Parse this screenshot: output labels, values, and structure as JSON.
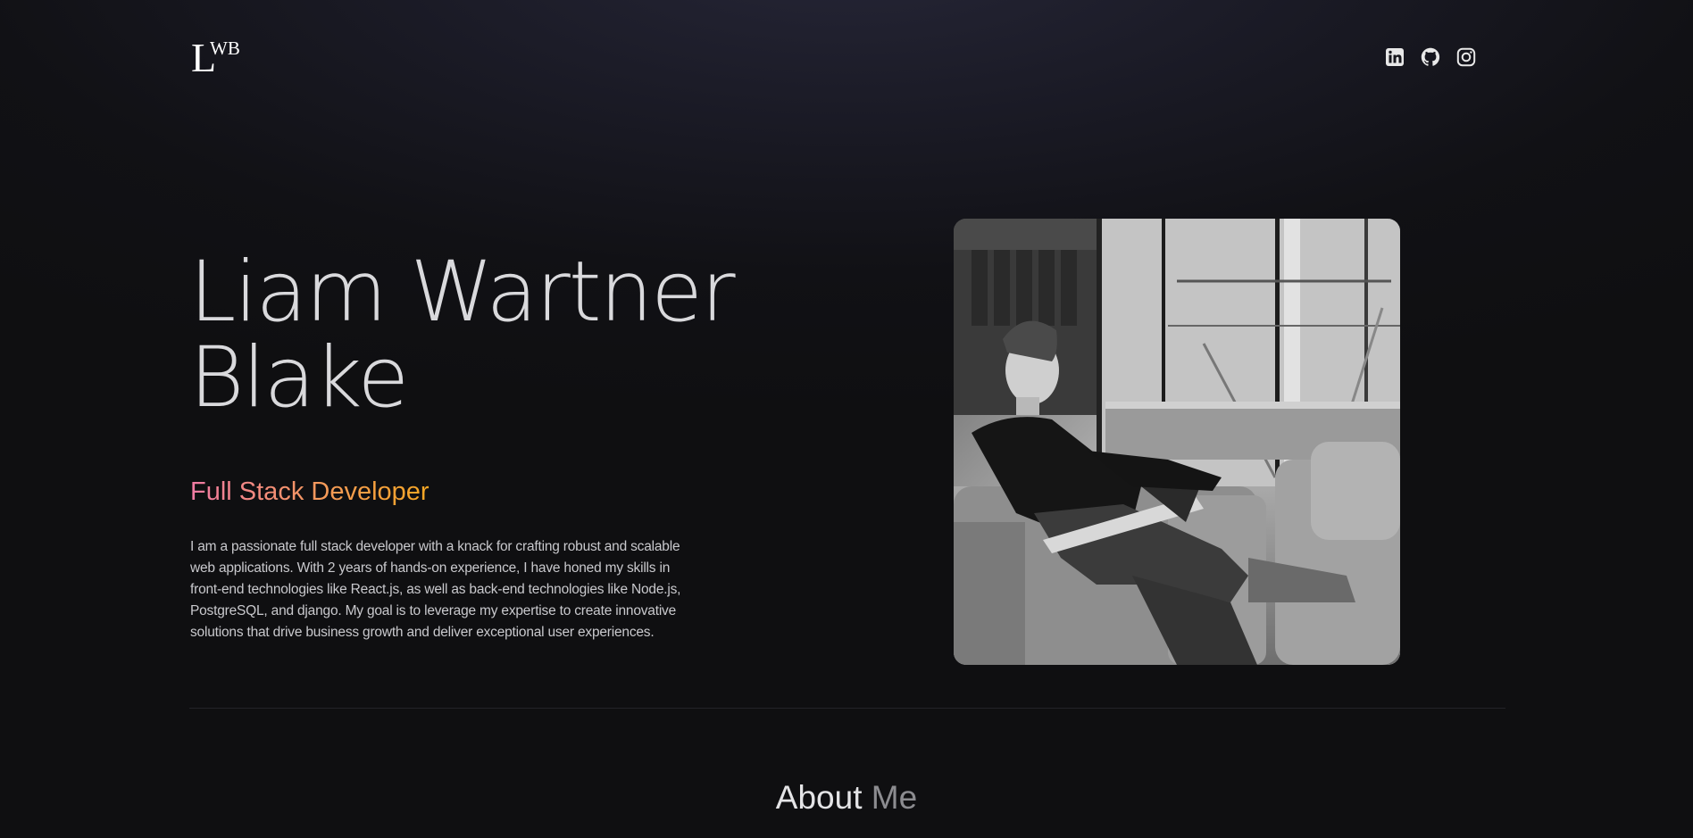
{
  "header": {
    "logo": {
      "big": "L",
      "small": "WB"
    },
    "socials": [
      {
        "icon": "linkedin-icon"
      },
      {
        "icon": "github-icon"
      },
      {
        "icon": "instagram-icon"
      }
    ]
  },
  "hero": {
    "name_line1": "Liam Wartner",
    "name_line2": "Blake",
    "role": "Full Stack Developer",
    "bio": "I am a passionate full stack developer with a knack for crafting robust and scalable web applications. With 2 years of hands-on experience, I have honed my skills in front-end technologies like React.js, as well as back-end technologies like Node.js, PostgreSQL, and django. My goal is to leverage my expertise to create innovative solutions that drive business growth and deliver exceptional user experiences."
  },
  "about": {
    "title_word1": "About",
    "title_word2": "Me"
  },
  "colors": {
    "role_gradient_start": "#f07aa4",
    "role_gradient_end": "#f5a623",
    "background": "#111115"
  }
}
